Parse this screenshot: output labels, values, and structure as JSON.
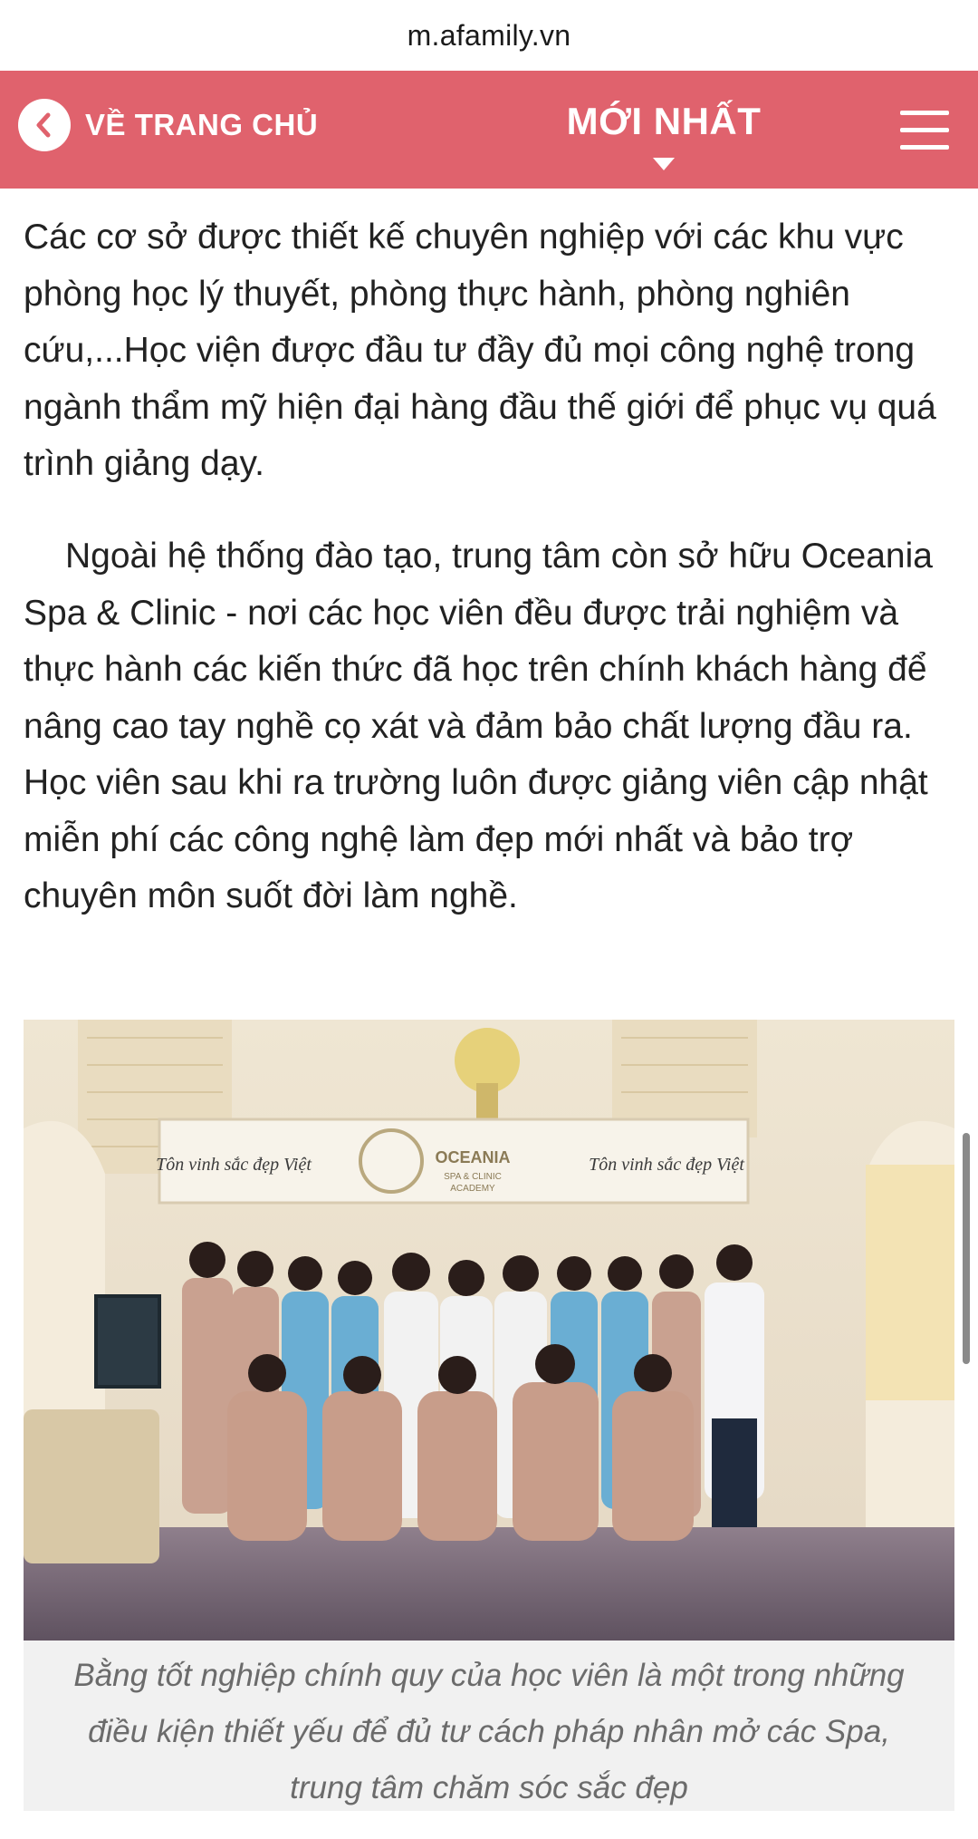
{
  "browser": {
    "url": "m.afamily.vn"
  },
  "nav": {
    "back_label": "VỀ TRANG CHỦ",
    "back_icon": "chevron-left-icon",
    "latest_label": "MỚI NHẤT",
    "latest_icon": "caret-down-icon",
    "menu_icon": "hamburger-menu-icon",
    "bar_color": "#e0626d"
  },
  "article": {
    "paragraphs": [
      "Các cơ sở được thiết kế chuyên nghiệp với các khu vực phòng học lý thuyết, phòng thực hành, phòng nghiên cứu,...Học viện được đầu tư đầy đủ mọi công nghệ trong ngành thẩm mỹ hiện đại hàng đầu thế giới để phục vụ quá trình giảng dạy.",
      "Ngoài hệ thống đào tạo, trung tâm còn sở hữu Oceania Spa & Clinic - nơi các học viên đều được trải nghiệm và thực hành các kiến thức đã học trên chính khách hàng để nâng cao tay nghề cọ xát và đảm bảo chất lượng đầu ra. Học viên sau khi ra trường luôn được giảng viên cập nhật miễn phí các công nghệ làm đẹp mới nhất và bảo trợ chuyên môn suốt đời làm nghề."
    ],
    "photo": {
      "sign_slogan_left": "Tôn vinh sắc đẹp Việt",
      "sign_brand": "OCEANIA",
      "sign_brand_sub": "SPA & CLINIC",
      "sign_brand_sub2": "ACADEMY",
      "sign_slogan_right": "Tôn vinh sắc đẹp Việt"
    },
    "caption": "Bằng tốt nghiệp chính quy của học viên là một trong những điều kiện thiết yếu để đủ tư cách pháp nhân mở các Spa, trung tâm chăm sóc sắc đẹp"
  }
}
